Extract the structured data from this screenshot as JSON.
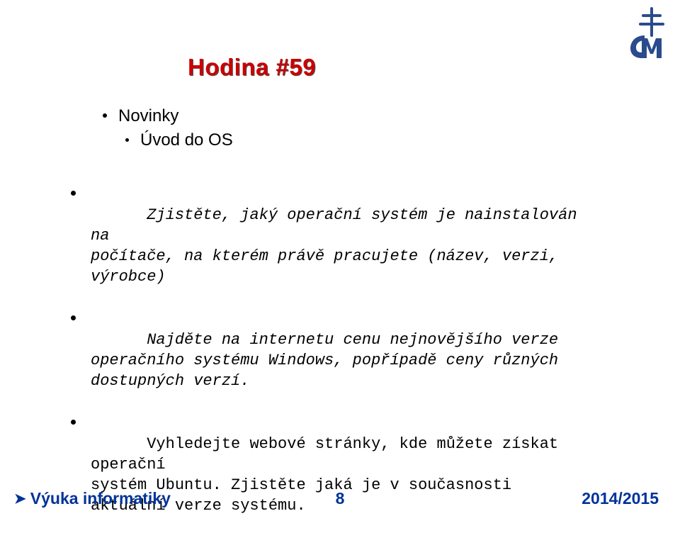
{
  "title": "Hodina #59",
  "items": [
    {
      "label": "Novinky",
      "sub": false
    },
    {
      "label": "Úvod do OS",
      "sub": true
    }
  ],
  "tasks": [
    {
      "text": "Zjistěte, jaký operační systém je nainstalován na\npočítače, na kterém právě pracujete (název, verzi,\nvýrobce)",
      "italic": true
    },
    {
      "text": "Najděte na internetu cenu nejnovějšího verze\noperačního systému Windows, popřípadě ceny různých\ndostupných verzí.",
      "italic": true
    },
    {
      "text": "Vyhledejte webové stránky, kde můžete získat operační\nsystém Ubuntu. Zjistěte jaká je v současnosti\naktuální verze systému.",
      "italic": false
    }
  ],
  "footer": {
    "left": "Výuka informatiky",
    "page": "8",
    "year": "2014/2015"
  }
}
